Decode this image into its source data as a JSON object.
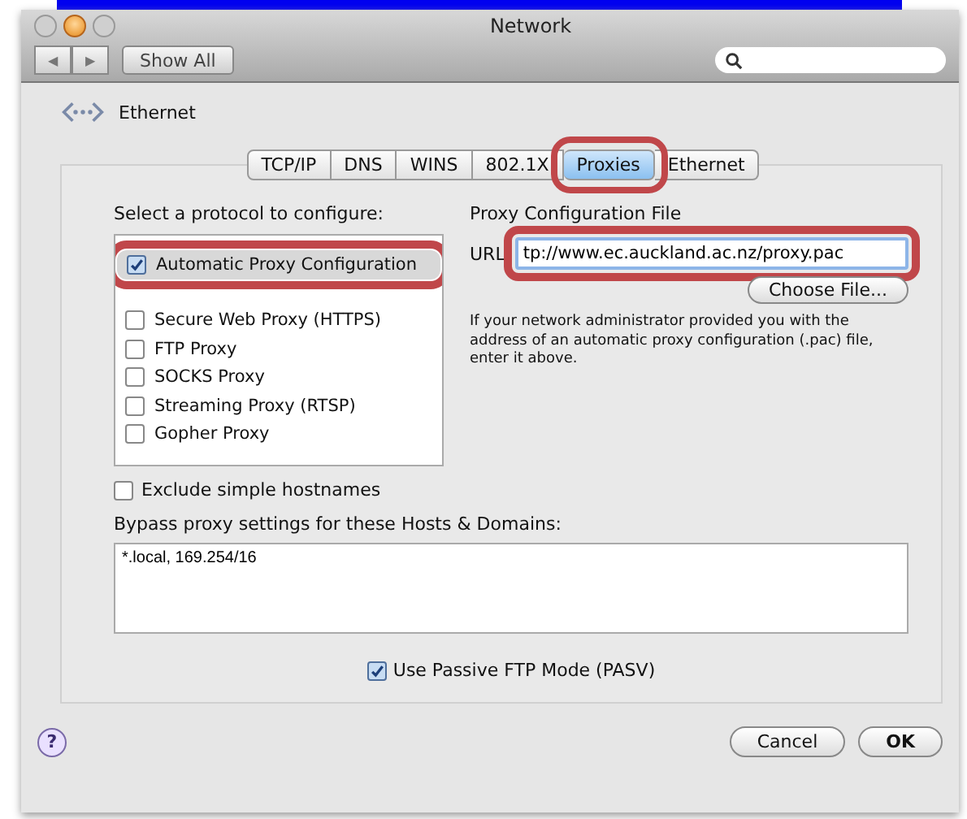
{
  "window": {
    "title": "Network",
    "nav": [
      "◀",
      "▶"
    ],
    "show_all": "Show All"
  },
  "service": {
    "name": "Ethernet"
  },
  "tabs": [
    {
      "label": "TCP/IP",
      "selected": false,
      "highlighted": false
    },
    {
      "label": "DNS",
      "selected": false,
      "highlighted": false
    },
    {
      "label": "WINS",
      "selected": false,
      "highlighted": false
    },
    {
      "label": "802.1X",
      "selected": false,
      "highlighted": false
    },
    {
      "label": "Proxies",
      "selected": true,
      "highlighted": true
    },
    {
      "label": "Ethernet",
      "selected": false,
      "highlighted": false
    }
  ],
  "protocols": {
    "label": "Select a protocol to configure:",
    "items": [
      {
        "label": "Automatic Proxy Configuration",
        "checked": true,
        "selected": true,
        "highlighted": true
      },
      {
        "label": "Secure Web Proxy (HTTPS)",
        "checked": false,
        "selected": false,
        "highlighted": false
      },
      {
        "label": "FTP Proxy",
        "checked": false,
        "selected": false,
        "highlighted": false
      },
      {
        "label": "SOCKS Proxy",
        "checked": false,
        "selected": false,
        "highlighted": false
      },
      {
        "label": "Streaming Proxy (RTSP)",
        "checked": false,
        "selected": false,
        "highlighted": false
      },
      {
        "label": "Gopher Proxy",
        "checked": false,
        "selected": false,
        "highlighted": false
      }
    ]
  },
  "config_file": {
    "title": "Proxy Configuration File",
    "url_label": "URL",
    "url_value": "tp://www.ec.auckland.ac.nz/proxy.pac",
    "url_highlighted": true,
    "choose_button": "Choose File...",
    "help_text": "If your network administrator provided you with the address of an automatic proxy configuration (.pac) file, enter it above."
  },
  "exclude_simple": {
    "label": "Exclude simple hostnames",
    "checked": false
  },
  "bypass": {
    "label": "Bypass proxy settings for these Hosts & Domains:",
    "value": "*.local, 169.254/16"
  },
  "passive_ftp": {
    "label": "Use Passive FTP Mode (PASV)",
    "checked": true
  },
  "help_button": "?",
  "buttons": [
    {
      "label": "Cancel",
      "kind": "cancel"
    },
    {
      "label": "OK",
      "kind": "default"
    }
  ]
}
